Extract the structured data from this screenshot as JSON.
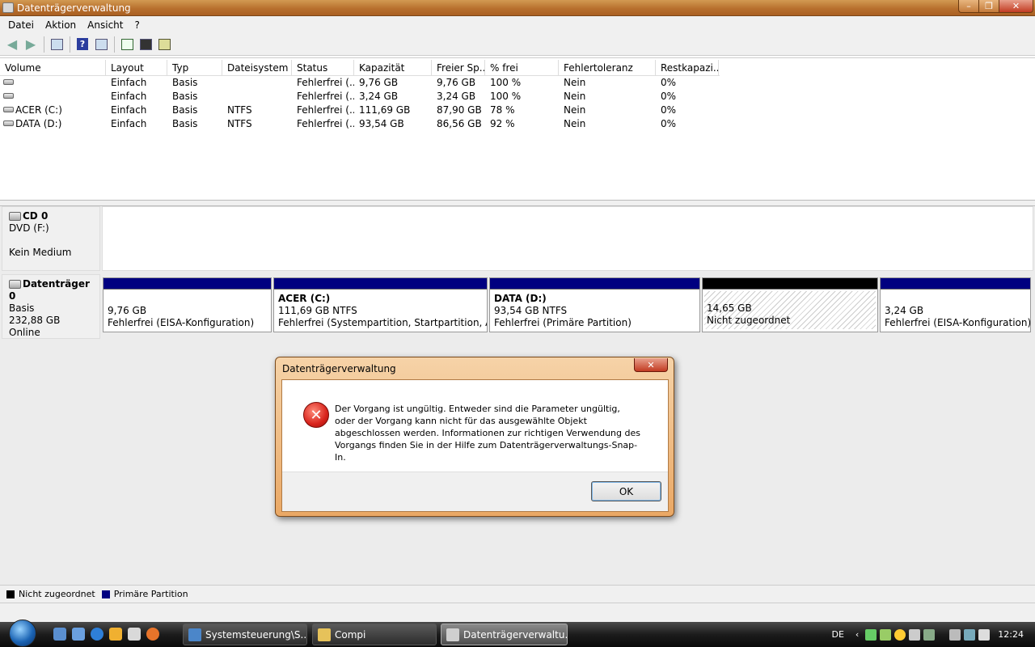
{
  "window": {
    "title": "Datenträgerverwaltung",
    "min": "–",
    "max": "❐",
    "close": "✕"
  },
  "menu": [
    "Datei",
    "Aktion",
    "Ansicht",
    "?"
  ],
  "toolbar": {
    "icons": [
      "back-arrow-icon",
      "forward-arrow-icon",
      "properties-icon",
      "help-icon",
      "view-icon",
      "refresh-icon",
      "rescan-icon",
      "settings-icon"
    ]
  },
  "volume_table": {
    "columns": [
      "Volume",
      "Layout",
      "Typ",
      "Dateisystem",
      "Status",
      "Kapazität",
      "Freier Sp...",
      "% frei",
      "Fehlertoleranz",
      "Restkapazi..."
    ],
    "rows": [
      [
        "",
        "Einfach",
        "Basis",
        "",
        "Fehlerfrei (...",
        "9,76 GB",
        "9,76 GB",
        "100 %",
        "Nein",
        "0%"
      ],
      [
        "",
        "Einfach",
        "Basis",
        "",
        "Fehlerfrei (...",
        "3,24 GB",
        "3,24 GB",
        "100 %",
        "Nein",
        "0%"
      ],
      [
        "ACER (C:)",
        "Einfach",
        "Basis",
        "NTFS",
        "Fehlerfrei (...",
        "111,69 GB",
        "87,90 GB",
        "78 %",
        "Nein",
        "0%"
      ],
      [
        "DATA (D:)",
        "Einfach",
        "Basis",
        "NTFS",
        "Fehlerfrei (...",
        "93,54 GB",
        "86,56 GB",
        "92 %",
        "Nein",
        "0%"
      ]
    ]
  },
  "cd": {
    "name": "CD 0",
    "drive": "DVD (F:)",
    "status": "Kein Medium"
  },
  "disk0": {
    "name": "Datenträger 0",
    "type": "Basis",
    "size": "232,88 GB",
    "status": "Online",
    "partitions": [
      {
        "label": "",
        "size": "9,76 GB",
        "status": "Fehlerfrei (EISA-Konfiguration)"
      },
      {
        "label": "ACER  (C:)",
        "size": "111,69 GB NTFS",
        "status": "Fehlerfrei (Systempartition, Startpartition, Auslag"
      },
      {
        "label": "DATA  (D:)",
        "size": "93,54 GB NTFS",
        "status": "Fehlerfrei (Primäre Partition)"
      },
      {
        "label": "",
        "size": "14,65 GB",
        "status": "Nicht zugeordnet"
      },
      {
        "label": "",
        "size": "3,24 GB",
        "status": "Fehlerfrei (EISA-Konfiguration)"
      }
    ]
  },
  "legend": {
    "unallocated": "Nicht zugeordnet",
    "primary": "Primäre Partition",
    "colors": {
      "unallocated": "#000000",
      "primary": "#000080"
    }
  },
  "dialog": {
    "title": "Datenträgerverwaltung",
    "message": "Der Vorgang ist ungültig. Entweder sind die Parameter ungültig, oder der Vorgang kann nicht für das ausgewählte Objekt abgeschlossen werden. Informationen zur richtigen Verwendung des Vorgangs finden Sie in der Hilfe zum Datenträgerverwaltungs-Snap-In.",
    "ok": "OK",
    "close": "✕"
  },
  "taskbar": {
    "tasks": [
      "Systemsteuerung\\S...",
      "Compi",
      "Datenträgerverwaltu..."
    ],
    "lang": "DE",
    "chevron": "‹",
    "clock": "12:24"
  }
}
